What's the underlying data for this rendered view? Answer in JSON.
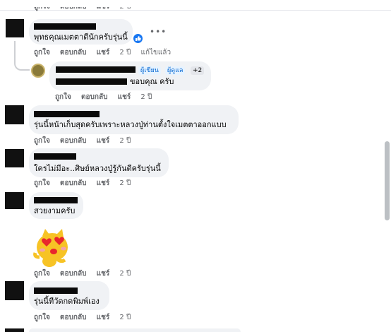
{
  "actions": {
    "like": "ถูกใจ",
    "reply": "ตอบกลับ",
    "share": "แชร์"
  },
  "time_ago": "2 ปี",
  "edited_label": "แก้ไขแล้ว",
  "comments": [
    {
      "text": "พุทธคุณเมตตาดีนักครับรุ่นนี้"
    },
    {
      "text": "ขอบคุณ ครับ",
      "badges": [
        "ผู้เขียน",
        "ผู้ดูแล",
        "+2"
      ]
    },
    {
      "text": "รุ่นนี้หน้าเก็บสุดครับเพราะหลวงปู่ท่านตั้งใจเมตตาออกแบบ"
    },
    {
      "text": "ใครไม่มีอะ..ศิษย์หลวงปู่รู้กันดีครับรุ่นนี้"
    },
    {
      "text": "สวยงามครับ",
      "sticker": "heart-eyes-sticker"
    },
    {
      "text": "รุ่นนี้ทีวัดกดพิมพ์เอง"
    }
  ],
  "colors": {
    "bubble": "#f0f2f5",
    "meta": "#65676b",
    "accent": "#1877f2"
  }
}
